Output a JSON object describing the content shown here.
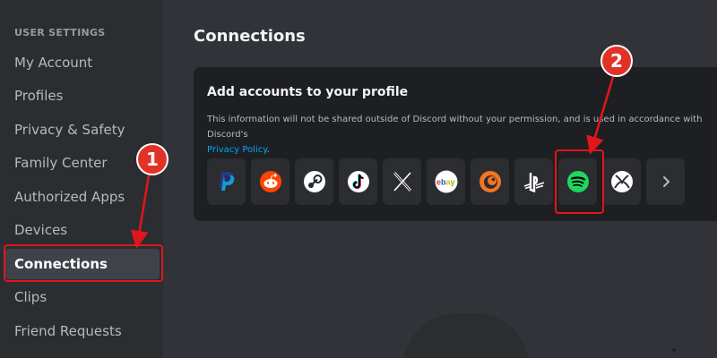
{
  "sidebar": {
    "header": "USER SETTINGS",
    "items": [
      {
        "label": "My Account"
      },
      {
        "label": "Profiles"
      },
      {
        "label": "Privacy & Safety"
      },
      {
        "label": "Family Center"
      },
      {
        "label": "Authorized Apps"
      },
      {
        "label": "Devices"
      },
      {
        "label": "Connections",
        "selected": true
      },
      {
        "label": "Clips"
      },
      {
        "label": "Friend Requests"
      }
    ]
  },
  "main": {
    "title": "Connections",
    "card": {
      "title": "Add accounts to your profile",
      "description": "This information will not be shared outside of Discord without your permission, and is used in accordance with Discord's",
      "link": "Privacy Policy",
      "link_suffix": "."
    },
    "services": [
      {
        "name": "PayPal",
        "icon": "paypal-icon",
        "color": "#253b80"
      },
      {
        "name": "Reddit",
        "icon": "reddit-icon",
        "color": "#ff4500"
      },
      {
        "name": "Steam",
        "icon": "steam-icon",
        "color": "#1b2838"
      },
      {
        "name": "TikTok",
        "icon": "tiktok-icon",
        "color": "#000000"
      },
      {
        "name": "X",
        "icon": "x-icon",
        "color": "#ffffff"
      },
      {
        "name": "eBay",
        "icon": "ebay-icon",
        "color": "#ffffff"
      },
      {
        "name": "Crunchyroll",
        "icon": "crunchyroll-icon",
        "color": "#f47521"
      },
      {
        "name": "PlayStation",
        "icon": "playstation-icon",
        "color": "#ffffff"
      },
      {
        "name": "Spotify",
        "icon": "spotify-icon",
        "color": "#1ed760"
      },
      {
        "name": "Xbox",
        "icon": "xbox-icon",
        "color": "#ffffff"
      },
      {
        "name": "More",
        "icon": "chevron-right-icon",
        "color": "#b5bac1"
      }
    ]
  },
  "annotations": {
    "step1": "1",
    "step2": "2",
    "color": "#e1161c"
  }
}
